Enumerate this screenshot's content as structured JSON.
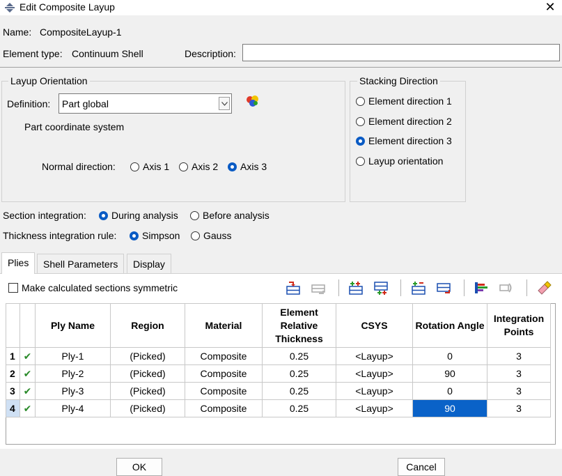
{
  "window": {
    "title": "Edit Composite Layup"
  },
  "fields": {
    "name_label": "Name:",
    "name_value": "CompositeLayup-1",
    "element_type_label": "Element type:",
    "element_type_value": "Continuum Shell",
    "description_label": "Description:",
    "description_value": ""
  },
  "layup_orientation": {
    "title": "Layup Orientation",
    "definition_label": "Definition:",
    "definition_value": "Part global",
    "coord_text": "Part coordinate system",
    "normal_label": "Normal direction:",
    "normal_options": [
      "Axis 1",
      "Axis 2",
      "Axis 3"
    ],
    "normal_selected": "Axis 3"
  },
  "stacking_direction": {
    "title": "Stacking Direction",
    "options": [
      "Element direction 1",
      "Element direction 2",
      "Element direction 3",
      "Layup orientation"
    ],
    "selected": "Element direction 3"
  },
  "section_integration": {
    "label": "Section integration:",
    "options": [
      "During analysis",
      "Before analysis"
    ],
    "selected": "During analysis"
  },
  "thickness_rule": {
    "label": "Thickness integration rule:",
    "options": [
      "Simpson",
      "Gauss"
    ],
    "selected": "Simpson"
  },
  "tabs": [
    {
      "label": "Plies",
      "active": true
    },
    {
      "label": "Shell Parameters",
      "active": false
    },
    {
      "label": "Display",
      "active": false
    }
  ],
  "plies_panel": {
    "symmetric_label": "Make calculated sections symmetric",
    "symmetric_checked": false
  },
  "table": {
    "headers": [
      "",
      "",
      "Ply Name",
      "Region",
      "Material",
      "Element Relative Thickness",
      "CSYS",
      "Rotation Angle",
      "Integration Points"
    ],
    "rows": [
      {
        "num": "1",
        "check": "✔",
        "ply": "Ply-1",
        "region": "(Picked)",
        "material": "Composite",
        "thickness": "0.25",
        "csys": "<Layup>",
        "angle": "0",
        "points": "3"
      },
      {
        "num": "2",
        "check": "✔",
        "ply": "Ply-2",
        "region": "(Picked)",
        "material": "Composite",
        "thickness": "0.25",
        "csys": "<Layup>",
        "angle": "90",
        "points": "3"
      },
      {
        "num": "3",
        "check": "✔",
        "ply": "Ply-3",
        "region": "(Picked)",
        "material": "Composite",
        "thickness": "0.25",
        "csys": "<Layup>",
        "angle": "0",
        "points": "3"
      },
      {
        "num": "4",
        "check": "✔",
        "ply": "Ply-4",
        "region": "(Picked)",
        "material": "Composite",
        "thickness": "0.25",
        "csys": "<Layup>",
        "angle": "90",
        "points": "3"
      }
    ],
    "selected_row": "4",
    "selected_cell": "Rotation Angle"
  },
  "buttons": {
    "ok": "OK",
    "cancel": "Cancel"
  },
  "colors": {
    "accent": "#0a5bc4",
    "selection": "#0a62c8",
    "check": "#2a8a2a"
  }
}
